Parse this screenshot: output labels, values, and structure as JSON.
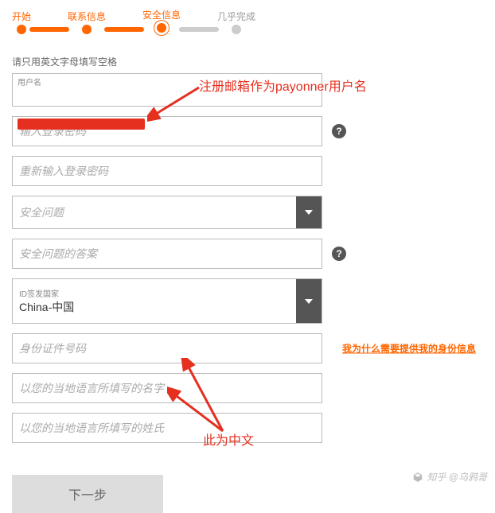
{
  "stepper": {
    "steps": [
      {
        "label": "开始",
        "active": true
      },
      {
        "label": "联系信息",
        "active": true
      },
      {
        "label": "安全信息",
        "active": true,
        "current": true
      },
      {
        "label": "几乎完成",
        "active": false
      }
    ]
  },
  "form": {
    "hint": "请只用英文字母填写空格",
    "username": {
      "label": "用户名",
      "value": ""
    },
    "password": {
      "placeholder": "输入登录密码"
    },
    "password2": {
      "placeholder": "重新输入登录密码"
    },
    "secQuestion": {
      "placeholder": "安全问题"
    },
    "secAnswer": {
      "placeholder": "安全问题的答案"
    },
    "idCountry": {
      "label": "ID签发国家",
      "value": "China-中国"
    },
    "idNumber": {
      "placeholder": "身份证件号码"
    },
    "localFirstName": {
      "placeholder": "以您的当地语言所填写的名字"
    },
    "localLastName": {
      "placeholder": "以您的当地语言所填写的姓氏"
    },
    "idInfoLink": "我为什么需要提供我的身份信息",
    "nextButton": "下一步"
  },
  "annotations": {
    "a1": "注册邮箱作为payonner用户名",
    "a2": "此为中文"
  },
  "watermark": "知乎 @乌鸦哥"
}
